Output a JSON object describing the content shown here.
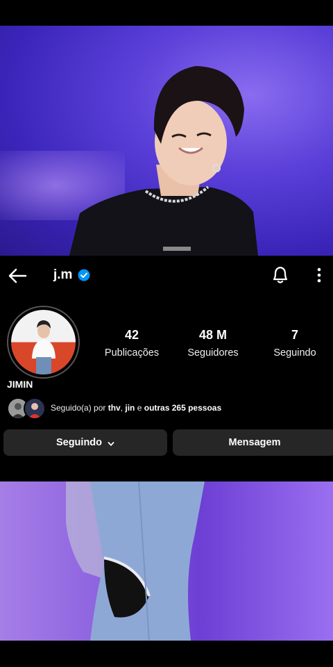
{
  "profile": {
    "username": "j.m",
    "display_name": "JIMIN",
    "stats": [
      {
        "value": "42",
        "label": "Publicações"
      },
      {
        "value": "48 M",
        "label": "Seguidores"
      },
      {
        "value": "7",
        "label": "Seguindo"
      }
    ],
    "followed_by": {
      "prefix": "Seguido(a) por ",
      "user1": "thv",
      "sep": ", ",
      "user2": "jin",
      "conj": " e ",
      "others": "outras 265 pessoas"
    }
  },
  "actions": {
    "following_label": "Seguindo",
    "message_label": "Mensagem"
  },
  "icons": {
    "back": "arrow-left-icon",
    "verified": "verified-badge-icon",
    "notifications": "bell-icon",
    "more": "more-vertical-icon",
    "dropdown": "chevron-down-icon"
  },
  "colors": {
    "background": "#000000",
    "button_bg": "#262626",
    "verified_blue": "#0095f6"
  }
}
